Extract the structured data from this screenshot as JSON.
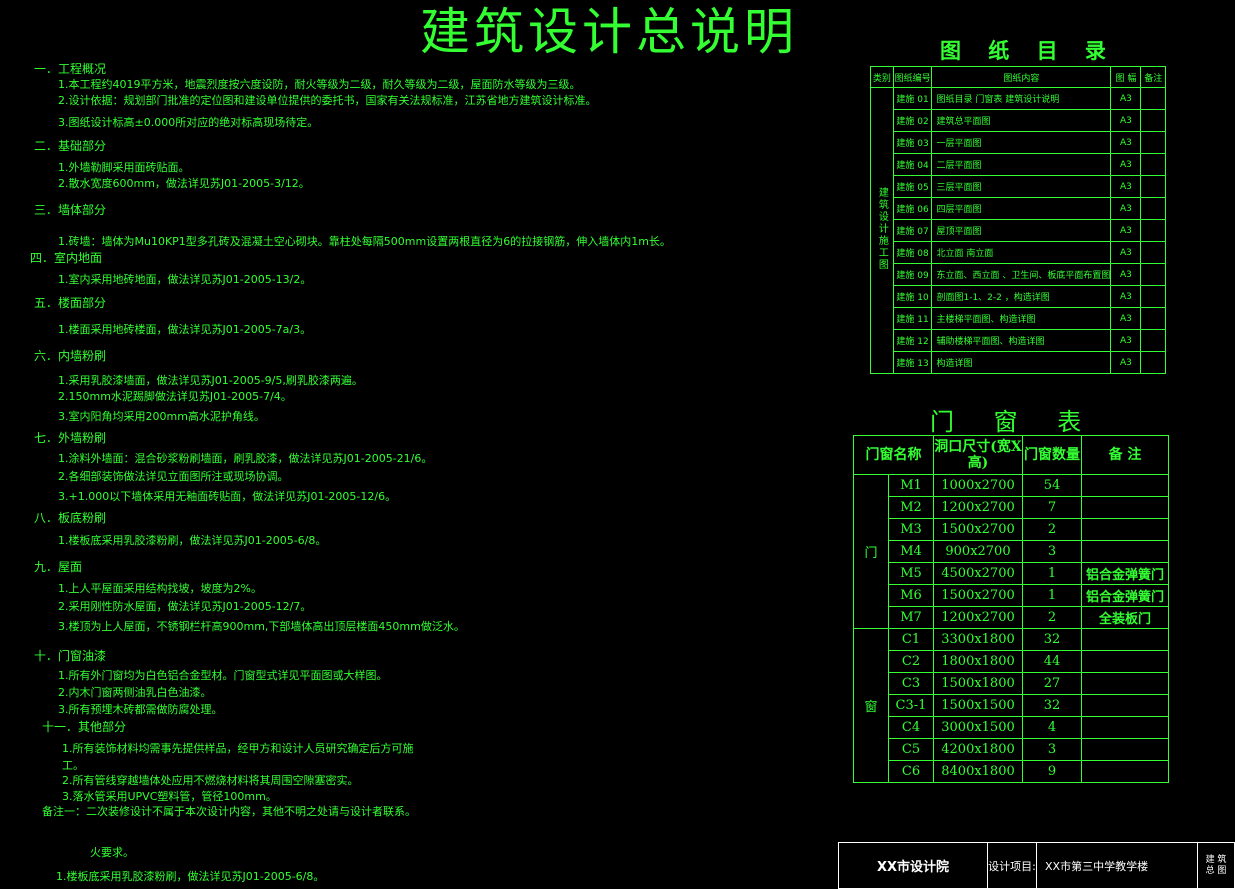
{
  "title": "建筑设计总说明",
  "notes": [
    {
      "heading": "一．工程概况",
      "lines": [
        "1.本工程约4019平方米，地震烈度按六度设防，耐火等级为二级，耐久等级为二级，屋面防水等级为三级。",
        "2.设计依据：规划部门批准的定位图和建设单位提供的委托书，国家有关法规标准，江苏省地方建筑设计标准。",
        "3.图纸设计标高±0.000所对应的绝对标高现场待定。"
      ]
    },
    {
      "heading": "二．基础部分",
      "lines": [
        "1.外墙勒脚采用面砖贴面。",
        "2.散水宽度600mm，做法详见苏J01-2005-3/12。"
      ]
    },
    {
      "heading": "三．墙体部分",
      "lines": [
        "1.砖墙：墙体为Mu10KP1型多孔砖及混凝土空心砌块。靠柱处每隔500mm设置两根直径为6的拉接钢筋，伸入墙体内1m长。"
      ]
    },
    {
      "heading": "四．室内地面",
      "lines": [
        "1.室内采用地砖地面，做法详见苏J01-2005-13/2。"
      ]
    },
    {
      "heading": "五．楼面部分",
      "lines": [
        "1.楼面采用地砖楼面，做法详见苏J01-2005-7a/3。"
      ]
    },
    {
      "heading": "六．内墙粉刷",
      "lines": [
        "1.采用乳胶漆墙面，做法详见苏J01-2005-9/5,刷乳胶漆两遍。",
        "2.150mm水泥踢脚做法详见苏J01-2005-7/4。",
        "3.室内阳角均采用200mm高水泥护角线。"
      ]
    },
    {
      "heading": "七．外墙粉刷",
      "lines": [
        "1.涂料外墙面：混合砂浆粉刷墙面，刷乳胶漆，做法详见苏J01-2005-21/6。",
        "2.各细部装饰做法详见立面图所注或现场协调。",
        "3.+1.000以下墙体采用无釉面砖贴面，做法详见苏J01-2005-12/6。"
      ]
    },
    {
      "heading": "八．板底粉刷",
      "lines": [
        "1.楼板底采用乳胶漆粉刷，做法详见苏J01-2005-6/8。"
      ]
    },
    {
      "heading": "九．屋面",
      "lines": [
        "1.上人平屋面采用结构找坡，坡度为2%。",
        "2.采用刚性防水屋面，做法详见苏J01-2005-12/7。",
        "3.楼顶为上人屋面，不锈钢栏杆高900mm,下部墙体高出顶层楼面450mm做泛水。"
      ]
    },
    {
      "heading": "十．门窗油漆",
      "lines": [
        "1.所有外门窗均为白色铝合金型材。门窗型式详见平面图或大样图。",
        "2.内木门窗两侧油乳白色油漆。",
        "3.所有预埋木砖都需做防腐处理。"
      ]
    },
    {
      "heading": "十一．其他部分",
      "lines": [
        "1.所有装饰材料均需事先提供样品，经甲方和设计人员研究确定后方可施",
        "工。",
        "2.所有管线穿越墙体处应用不燃烧材料将其周围空隙塞密实。",
        "3.落水管采用UPVC塑料管，管径100mm。"
      ]
    }
  ],
  "extra_note": "备注一：二次装修设计不属于本次设计内容，其他不明之处请与设计者联系。",
  "extra_lines": [
    "火要求。",
    "1.楼板底采用乳胶漆粉刷，做法详见苏J01-2005-6/8。"
  ],
  "drawings": {
    "title": "图 纸 目 录",
    "headers": [
      "类别",
      "图纸编号",
      "图纸内容",
      "图 幅",
      "备注"
    ],
    "category": "建筑设计施工图",
    "rows": [
      [
        "建施 01",
        "图纸目录 门窗表 建筑设计说明",
        "A3"
      ],
      [
        "建施 02",
        "建筑总平面图",
        "A3"
      ],
      [
        "建施 03",
        "一层平面图",
        "A3"
      ],
      [
        "建施 04",
        "二层平面图",
        "A3"
      ],
      [
        "建施 05",
        "三层平面图",
        "A3"
      ],
      [
        "建施 06",
        "四层平面图",
        "A3"
      ],
      [
        "建施 07",
        "屋顶平面图",
        "A3"
      ],
      [
        "建施 08",
        "北立面 南立面",
        "A3"
      ],
      [
        "建施 09",
        "东立面、西立面 、卫生间、板底平面布置图",
        "A3"
      ],
      [
        "建施 10",
        "剖面图1-1、2-2 ，构造详图",
        "A3"
      ],
      [
        "建施 11",
        "主楼梯平面图、构造详图",
        "A3"
      ],
      [
        "建施 12",
        "辅助楼梯平面图、构造详图",
        "A3"
      ],
      [
        "建施 13",
        "构造详图",
        "A3"
      ]
    ]
  },
  "doors": {
    "title": "门 窗 表",
    "headers": [
      "门窗名称",
      "洞口尺寸(宽X高)",
      "门窗数量",
      "备 注"
    ],
    "door_label": "门",
    "window_label": "窗",
    "door_rows": [
      [
        "M1",
        "1000x2700",
        "54",
        ""
      ],
      [
        "M2",
        "1200x2700",
        "7",
        ""
      ],
      [
        "M3",
        "1500x2700",
        "2",
        ""
      ],
      [
        "M4",
        "900x2700",
        "3",
        ""
      ],
      [
        "M5",
        "4500x2700",
        "1",
        "铝合金弹簧门"
      ],
      [
        "M6",
        "1500x2700",
        "1",
        "铝合金弹簧门"
      ],
      [
        "M7",
        "1200x2700",
        "2",
        "全装板门"
      ]
    ],
    "window_rows": [
      [
        "C1",
        "3300x1800",
        "32",
        ""
      ],
      [
        "C2",
        "1800x1800",
        "44",
        ""
      ],
      [
        "C3",
        "1500x1800",
        "27",
        ""
      ],
      [
        "C3-1",
        "1500x1500",
        "32",
        ""
      ],
      [
        "C4",
        "3000x1500",
        "4",
        ""
      ],
      [
        "C5",
        "4200x1800",
        "3",
        ""
      ],
      [
        "C6",
        "8400x1800",
        "9",
        ""
      ]
    ]
  },
  "titleblock": {
    "institute": "XX市设计院",
    "project_label": "设计项目:",
    "project": "XX市第三中学教学楼",
    "right_top": "建 筑",
    "right_mid": "总 图"
  }
}
